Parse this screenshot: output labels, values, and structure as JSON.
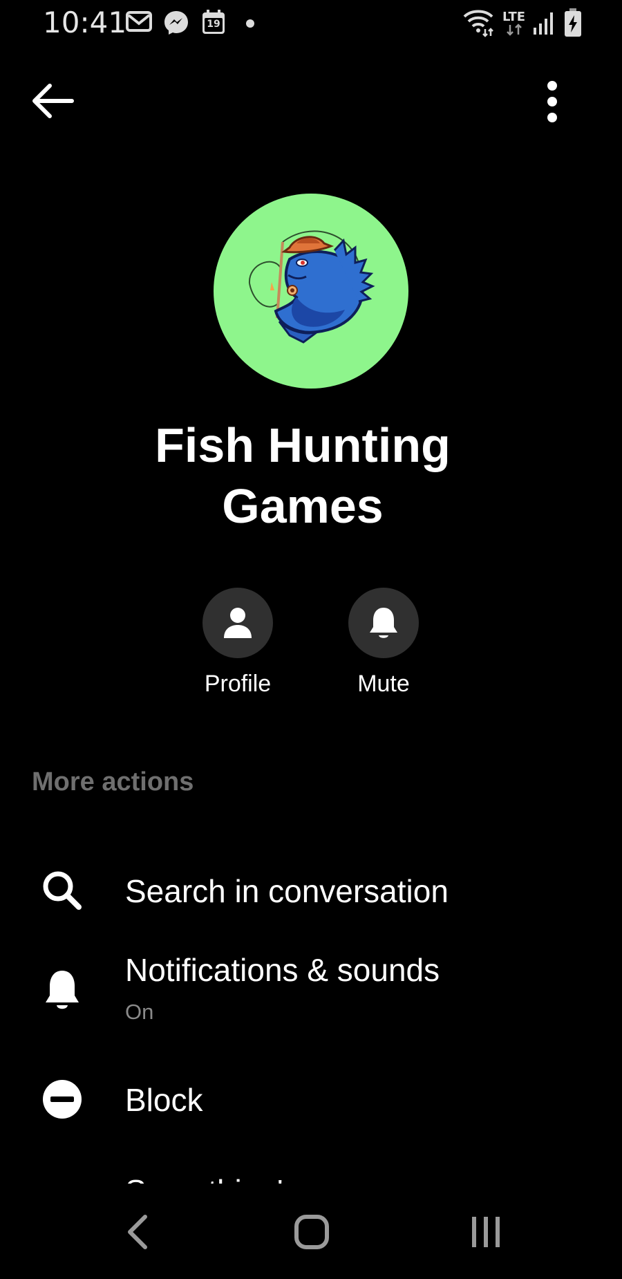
{
  "status_bar": {
    "time": "10:41",
    "calendar_day": "19",
    "network": "LTE",
    "icons": [
      "gmail-icon",
      "messenger-icon",
      "calendar-icon",
      "wifi-icon",
      "lte-icon",
      "signal-icon",
      "battery-charging-icon"
    ]
  },
  "header": {
    "title": "Fish Hunting Games",
    "avatar_color": "#8ef58c"
  },
  "quick_actions": [
    {
      "label": "Profile",
      "icon": "person-icon"
    },
    {
      "label": "Mute",
      "icon": "bell-icon"
    }
  ],
  "more_actions": {
    "title": "More actions",
    "items": [
      {
        "label": "Search in conversation",
        "icon": "search-icon"
      },
      {
        "label": "Notifications & sounds",
        "sublabel": "On",
        "icon": "bell-icon"
      },
      {
        "label": "Block",
        "icon": "block-icon"
      },
      {
        "label": "Something's wrong",
        "icon": "warning-icon"
      }
    ]
  },
  "nav_bar": {
    "buttons": [
      "back",
      "home",
      "recents"
    ]
  }
}
